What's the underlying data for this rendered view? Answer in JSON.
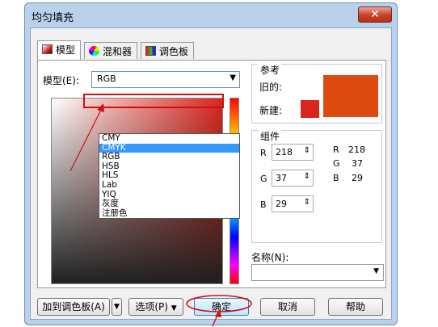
{
  "window": {
    "title": "均匀填充",
    "close_glyph": "✕"
  },
  "tabs": [
    {
      "label": "模型",
      "icon": "model-icon"
    },
    {
      "label": "混和器",
      "icon": "mixer-icon"
    },
    {
      "label": "调色板",
      "icon": "palette-icon"
    }
  ],
  "model": {
    "label": "模型(E):",
    "selected": "RGB",
    "options": [
      "CMY",
      "CMYK",
      "RGB",
      "HSB",
      "HLS",
      "Lab",
      "YIQ",
      "灰度",
      "注册色"
    ],
    "highlighted": "CMYK"
  },
  "reference": {
    "title": "参考",
    "old_label": "旧的:",
    "new_label": "新建:",
    "old_color": "#dd4a0f",
    "new_color": "#da251d"
  },
  "components": {
    "title": "组件",
    "channels": [
      {
        "label": "R",
        "value": "218"
      },
      {
        "label": "G",
        "value": "37"
      },
      {
        "label": "B",
        "value": "29"
      }
    ],
    "readout": [
      {
        "label": "R",
        "value": "218"
      },
      {
        "label": "G",
        "value": "37"
      },
      {
        "label": "B",
        "value": "29"
      }
    ]
  },
  "name": {
    "label": "名称(N):",
    "value": ""
  },
  "buttons": {
    "add_palette": "加到调色板(A)",
    "options": "选项(P)",
    "ok": "确定",
    "cancel": "取消",
    "help": "帮助"
  },
  "colors": {
    "annotation_red": "#cc1111",
    "selection_blue": "#3399ff"
  }
}
